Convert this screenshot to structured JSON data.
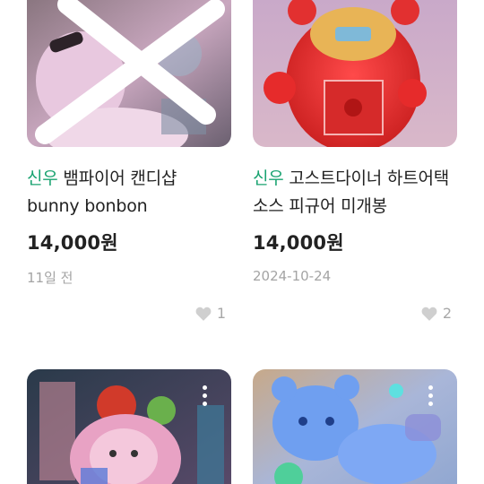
{
  "products": [
    {
      "shop": "신우",
      "title": "뱀파이어 캔디샵 bunny bonbon",
      "price": "14,000원",
      "date": "11일 전",
      "likes": "1",
      "image": "figure-photo-crossed-out"
    },
    {
      "shop": "신우",
      "title": "고스트다이너 하트어택 소스 피규어 미개봉",
      "price": "14,000원",
      "date": "2024-10-24",
      "likes": "2",
      "image": "red-figure-photo"
    },
    {
      "image": "colorful-figure-photo",
      "more_icon": "more-vertical-icon"
    },
    {
      "image": "blue-bear-figure-photo",
      "more_icon": "more-vertical-icon"
    }
  ],
  "colors": {
    "shop_name": "#1aa371",
    "text": "#222222",
    "muted": "#a4a4a4"
  }
}
